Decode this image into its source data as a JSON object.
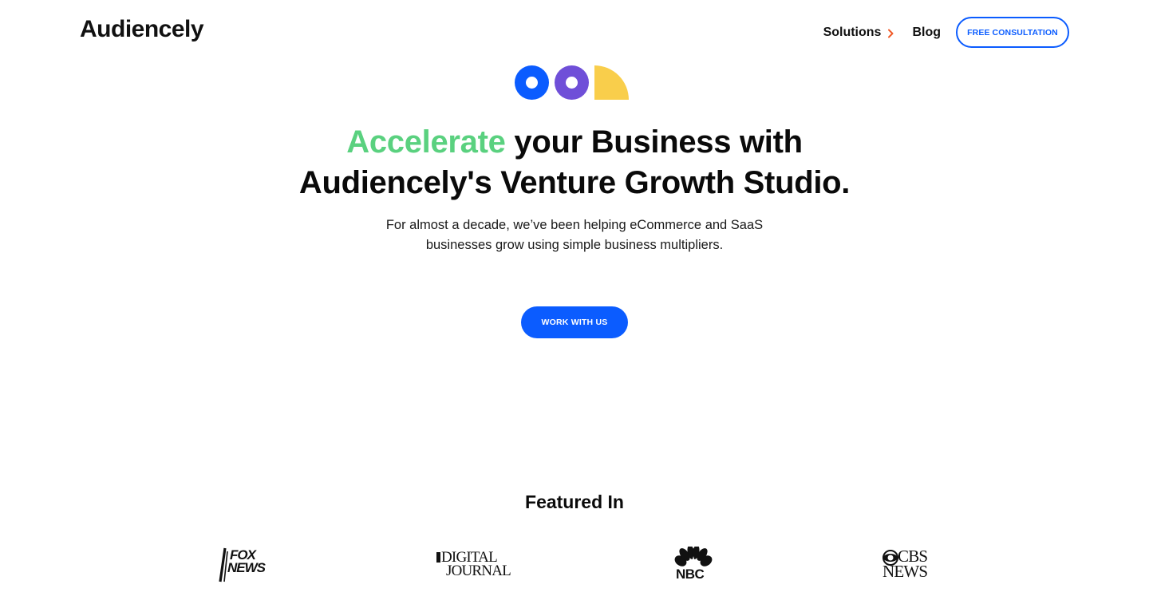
{
  "header": {
    "logo": "Audiencely",
    "nav": {
      "solutions_label": "Solutions",
      "blog_label": "Blog",
      "cta_label": "FREE CONSULTATION"
    }
  },
  "hero": {
    "headline_accent": "Accelerate",
    "headline_line1_rest": " your Business with",
    "headline_line2": "Audiencely's Venture Growth Studio.",
    "subtext_line1": "For almost a decade, we’ve been helping eCommerce and SaaS",
    "subtext_line2": "businesses grow using simple business multipliers.",
    "cta_label": "WORK WITH US"
  },
  "featured": {
    "title": "Featured In",
    "logos": [
      {
        "name": "fox-news",
        "line1": "FOX",
        "line2": "NEWS"
      },
      {
        "name": "digital-journal",
        "line1": "DIGITAL",
        "line2": "JOURNAL"
      },
      {
        "name": "nbc",
        "label": "NBC"
      },
      {
        "name": "cbs-news",
        "line1": "CBS",
        "line2": "NEWS"
      }
    ]
  },
  "colors": {
    "brand_blue": "#0b5cff",
    "accent_green": "#5ad17f",
    "purple": "#6f4fd8",
    "yellow": "#f9ce4b",
    "solutions_chevron": "#f05a28"
  }
}
